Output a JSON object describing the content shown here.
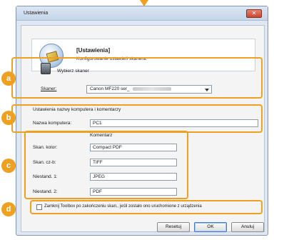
{
  "window": {
    "title": "Ustawienia",
    "close_glyph": "✕"
  },
  "header": {
    "title": "[Ustawienia]",
    "subtitle": "Konfigurowanie ustawień skanera.",
    "icon": "settings-disc-icon"
  },
  "section_a": {
    "badge": "a",
    "title": "Wybierz skaner",
    "scanner_label": "Skaner:",
    "scanner_value": "Canon MF220 ser_"
  },
  "section_b": {
    "badge": "b",
    "title": "Ustawienia nazwy komputera i komentarzy",
    "computer_label": "Nazwa komputera:",
    "computer_value": "PC1"
  },
  "section_c": {
    "badge": "c",
    "column_header": "Komentarz",
    "rows": [
      {
        "label": "Skan. kolor:",
        "value": "Compact PDF"
      },
      {
        "label": "Skan. cz-b:",
        "value": "TIFF"
      },
      {
        "label": "Niestand. 1:",
        "value": "JPEG"
      },
      {
        "label": "Niestand. 2:",
        "value": "PDF"
      }
    ]
  },
  "section_d": {
    "badge": "d",
    "checkbox_label": "Zamknij Toolbox po zakończeniu skan., jeśli zostało ono uruchomione z urządzenia",
    "checked": false
  },
  "buttons": {
    "reset": "Resetuj",
    "ok": "OK",
    "cancel": "Anuluj"
  },
  "colors": {
    "callout": "#f0a020",
    "dialog_bg": "#dfe8f2",
    "ok_border": "#3d7bd0"
  }
}
